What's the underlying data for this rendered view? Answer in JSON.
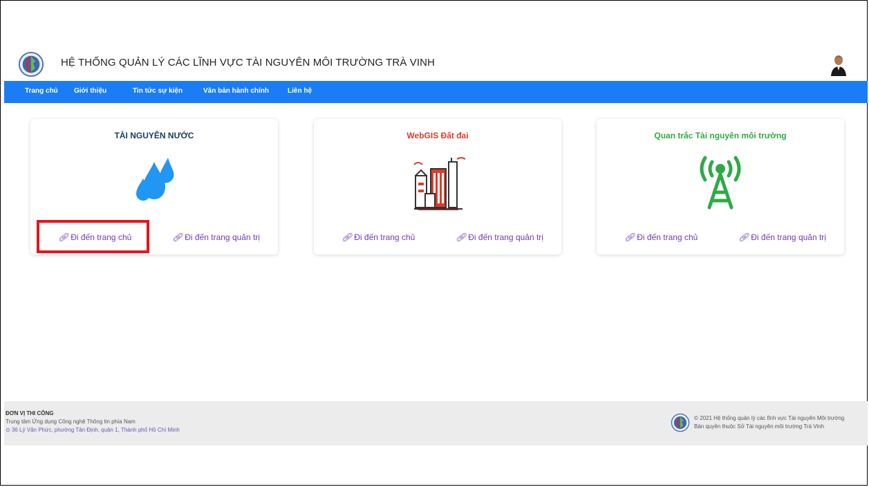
{
  "header": {
    "title": "HỆ THỐNG QUẢN LÝ CÁC LĨNH VỰC TÀI NGUYÊN MÔI TRƯỜNG TRÀ VINH"
  },
  "nav": [
    "Trang chủ",
    "Giới thiệu",
    "Tin tức sự kiện",
    "Văn bản hành chính",
    "Liên hệ"
  ],
  "cards": [
    {
      "title": "TÀI NGUYÊN NƯỚC",
      "title_color": "#1b3b5e",
      "icon": "water-drops-icon",
      "link_home": "Đi đến trang chủ",
      "link_admin": "Đi đến trang quản trị"
    },
    {
      "title": "WebGIS Đất đai",
      "title_color": "#e03a2b",
      "icon": "city-buildings-icon",
      "link_home": "Đi đến trang chủ",
      "link_admin": "Đi đến trang quản trị"
    },
    {
      "title": "Quan trắc Tài nguyên môi trường",
      "title_color": "#2eaa45",
      "icon": "antenna-tower-icon",
      "link_home": "Đi đến trang chủ",
      "link_admin": "Đi đến trang quản trị"
    }
  ],
  "footer": {
    "heading": "ĐƠN VỊ THI CÔNG",
    "org": "Trung tâm Ứng dụng Công nghệ Thông tin phía Nam",
    "address": "36 Lý Văn Phức, phường Tân Định, quận 1, Thành phố Hồ Chí Minh",
    "copyright": "© 2021 Hệ thống quản lý các lĩnh vực Tài nguyên Môi trường",
    "owner": "Bản quyền thuộc Sở Tài nguyên môi trường Trà Vinh"
  },
  "colors": {
    "nav_bg": "#1a7df6",
    "link": "#6f3bbb",
    "highlight": "#e8141b"
  }
}
